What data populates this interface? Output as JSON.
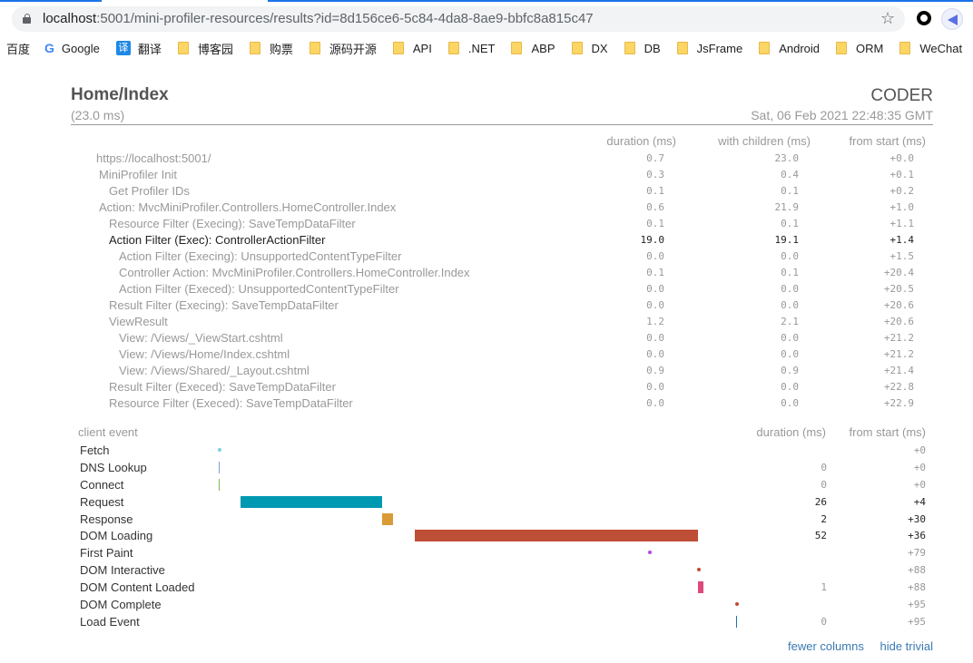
{
  "browser": {
    "url_host": "localhost",
    "url_rest": ":5001/mini-profiler-resources/results?id=8d156ce6-5c84-4da8-8ae9-bbfc8a815c47",
    "bookmarks": [
      {
        "label": "百度",
        "icon": "none"
      },
      {
        "label": "Google",
        "icon": "google-icon"
      },
      {
        "label": "翻译",
        "icon": "translate-icon"
      },
      {
        "label": "博客园",
        "icon": "folder-icon"
      },
      {
        "label": "购票",
        "icon": "folder-icon"
      },
      {
        "label": "源码开源",
        "icon": "folder-icon"
      },
      {
        "label": "API",
        "icon": "folder-icon"
      },
      {
        "label": ".NET",
        "icon": "folder-icon"
      },
      {
        "label": "ABP",
        "icon": "folder-icon"
      },
      {
        "label": "DX",
        "icon": "folder-icon"
      },
      {
        "label": "DB",
        "icon": "folder-icon"
      },
      {
        "label": "JsFrame",
        "icon": "folder-icon"
      },
      {
        "label": "Android",
        "icon": "folder-icon"
      },
      {
        "label": "ORM",
        "icon": "folder-icon"
      },
      {
        "label": "WeChat",
        "icon": "folder-icon"
      },
      {
        "label": "",
        "icon": "folder-icon"
      }
    ]
  },
  "profiler": {
    "title": "Home/Index",
    "total": "(23.0 ms)",
    "user": "CODER",
    "date": "Sat, 06 Feb 2021 22:48:35 GMT",
    "columns": {
      "duration": "duration (ms)",
      "with_children": "with children (ms)",
      "from_start": "from start (ms)"
    },
    "timings": [
      {
        "name": "https://localhost:5001/",
        "depth": 0,
        "duration": "0.7",
        "with_children": "23.0",
        "from_start": "+0.0",
        "highlight": false
      },
      {
        "name": "MiniProfiler Init",
        "depth": 1,
        "duration": "0.3",
        "with_children": "0.4",
        "from_start": "+0.1",
        "highlight": false
      },
      {
        "name": "Get Profiler IDs",
        "depth": 2,
        "duration": "0.1",
        "with_children": "0.1",
        "from_start": "+0.2",
        "highlight": false
      },
      {
        "name": "Action: MvcMiniProfiler.Controllers.HomeController.Index",
        "depth": 1,
        "duration": "0.6",
        "with_children": "21.9",
        "from_start": "+1.0",
        "highlight": false
      },
      {
        "name": "Resource Filter (Execing): SaveTempDataFilter",
        "depth": 2,
        "duration": "0.1",
        "with_children": "0.1",
        "from_start": "+1.1",
        "highlight": false
      },
      {
        "name": "Action Filter (Exec): ControllerActionFilter",
        "depth": 2,
        "duration": "19.0",
        "with_children": "19.1",
        "from_start": "+1.4",
        "highlight": true
      },
      {
        "name": "Action Filter (Execing): UnsupportedContentTypeFilter",
        "depth": 3,
        "duration": "0.0",
        "with_children": "0.0",
        "from_start": "+1.5",
        "highlight": false
      },
      {
        "name": "Controller Action: MvcMiniProfiler.Controllers.HomeController.Index",
        "depth": 3,
        "duration": "0.1",
        "with_children": "0.1",
        "from_start": "+20.4",
        "highlight": false
      },
      {
        "name": "Action Filter (Execed): UnsupportedContentTypeFilter",
        "depth": 3,
        "duration": "0.0",
        "with_children": "0.0",
        "from_start": "+20.5",
        "highlight": false
      },
      {
        "name": "Result Filter (Execing): SaveTempDataFilter",
        "depth": 2,
        "duration": "0.0",
        "with_children": "0.0",
        "from_start": "+20.6",
        "highlight": false
      },
      {
        "name": "ViewResult",
        "depth": 2,
        "duration": "1.2",
        "with_children": "2.1",
        "from_start": "+20.6",
        "highlight": false
      },
      {
        "name": "View: /Views/_ViewStart.cshtml",
        "depth": 3,
        "duration": "0.0",
        "with_children": "0.0",
        "from_start": "+21.2",
        "highlight": false
      },
      {
        "name": "View: /Views/Home/Index.cshtml",
        "depth": 3,
        "duration": "0.0",
        "with_children": "0.0",
        "from_start": "+21.2",
        "highlight": false
      },
      {
        "name": "View: /Views/Shared/_Layout.cshtml",
        "depth": 3,
        "duration": "0.9",
        "with_children": "0.9",
        "from_start": "+21.4",
        "highlight": false
      },
      {
        "name": "Result Filter (Execed): SaveTempDataFilter",
        "depth": 2,
        "duration": "0.0",
        "with_children": "0.0",
        "from_start": "+22.8",
        "highlight": false
      },
      {
        "name": "Resource Filter (Execed): SaveTempDataFilter",
        "depth": 2,
        "duration": "0.0",
        "with_children": "0.0",
        "from_start": "+22.9",
        "highlight": false
      }
    ],
    "client": {
      "header": "client event",
      "duration_header": "duration (ms)",
      "from_start_header": "from start (ms)",
      "timeline_max_ms": 95,
      "events": [
        {
          "name": "Fetch",
          "start": 0,
          "duration": null,
          "duration_text": "",
          "from_start_text": "+0",
          "kind": "point",
          "color": "#7fcfe0",
          "dark": false
        },
        {
          "name": "DNS Lookup",
          "start": 0,
          "duration": 0,
          "duration_text": "0",
          "from_start_text": "+0",
          "kind": "line",
          "color": "#7b9ed6",
          "dark": false
        },
        {
          "name": "Connect",
          "start": 0,
          "duration": 0,
          "duration_text": "0",
          "from_start_text": "+0",
          "kind": "line",
          "color": "#7fb84f",
          "dark": false
        },
        {
          "name": "Request",
          "start": 4,
          "duration": 26,
          "duration_text": "26",
          "from_start_text": "+4",
          "kind": "bar",
          "color": "#0099b2",
          "dark": true
        },
        {
          "name": "Response",
          "start": 30,
          "duration": 2,
          "duration_text": "2",
          "from_start_text": "+30",
          "kind": "bar",
          "color": "#d99b35",
          "dark": true
        },
        {
          "name": "DOM Loading",
          "start": 36,
          "duration": 52,
          "duration_text": "52",
          "from_start_text": "+36",
          "kind": "bar",
          "color": "#bf4e36",
          "dark": true
        },
        {
          "name": "First Paint",
          "start": 79,
          "duration": null,
          "duration_text": "",
          "from_start_text": "+79",
          "kind": "point",
          "color": "#b848e0",
          "dark": false
        },
        {
          "name": "DOM Interactive",
          "start": 88,
          "duration": null,
          "duration_text": "",
          "from_start_text": "+88",
          "kind": "point",
          "color": "#c24a35",
          "dark": false
        },
        {
          "name": "DOM Content Loaded",
          "start": 88,
          "duration": 1,
          "duration_text": "1",
          "from_start_text": "+88",
          "kind": "bar",
          "color": "#dc4a7c",
          "dark": false
        },
        {
          "name": "DOM Complete",
          "start": 95,
          "duration": null,
          "duration_text": "",
          "from_start_text": "+95",
          "kind": "point",
          "color": "#c24a35",
          "dark": false
        },
        {
          "name": "Load Event",
          "start": 95,
          "duration": 0,
          "duration_text": "0",
          "from_start_text": "+95",
          "kind": "line",
          "color": "#1f6fae",
          "dark": false
        }
      ]
    },
    "links": {
      "fewer_columns": "fewer columns",
      "hide_trivial": "hide trivial"
    }
  }
}
